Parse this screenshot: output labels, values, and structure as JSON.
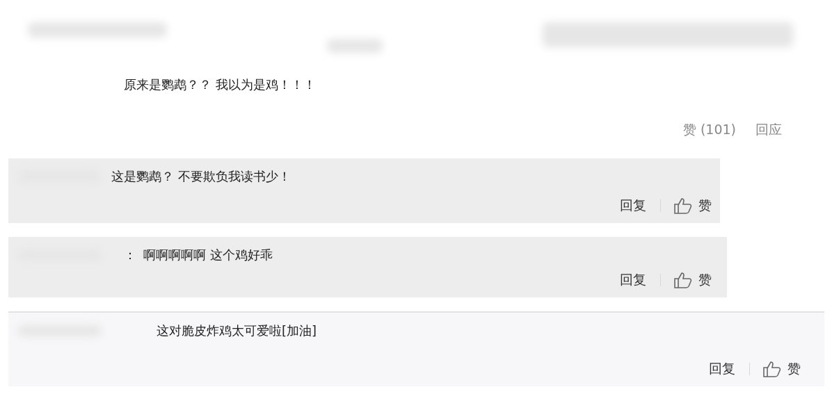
{
  "comment": {
    "text": "原来是鹦鹉？？ 我以为是鸡！！！",
    "like": "赞 (101)",
    "reply": "回应"
  },
  "replies": [
    {
      "text": "这是鹦鹉？ 不要欺负我读书少！",
      "reply": "回复",
      "like": "赞"
    },
    {
      "prefix": "：",
      "text": "啊啊啊啊啊 这个鸡好乖",
      "reply": "回复",
      "like": "赞"
    },
    {
      "text": "这对脆皮炸鸡太可爱啦[加油]",
      "reply": "回复",
      "like": "赞"
    }
  ]
}
